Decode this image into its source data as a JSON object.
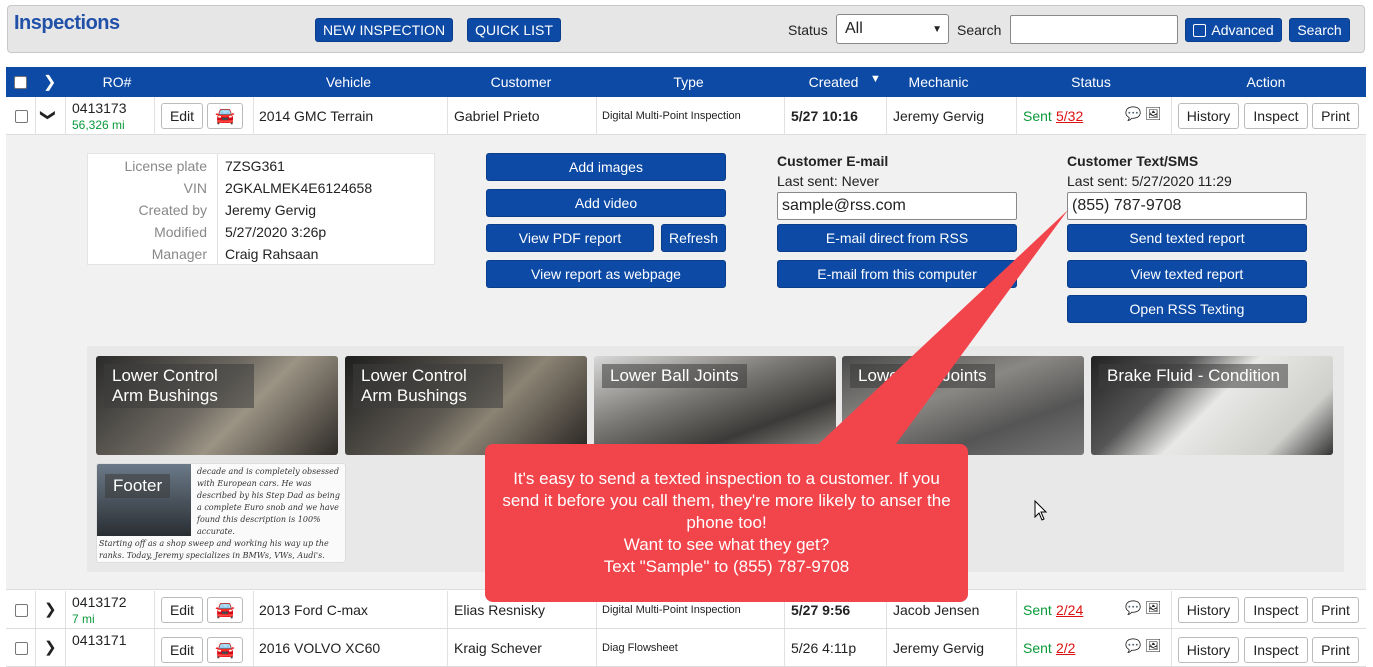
{
  "header": {
    "title": "Inspections",
    "new_inspection": "NEW INSPECTION",
    "quick_list": "QUICK LIST",
    "status_label": "Status",
    "status_value": "All",
    "search_label": "Search",
    "search_value": "",
    "advanced_label": "Advanced",
    "search_button": "Search"
  },
  "table": {
    "columns": [
      "RO#",
      "Vehicle",
      "Customer",
      "Type",
      "Created",
      "Mechanic",
      "Status",
      "Action"
    ]
  },
  "rows": [
    {
      "ro": "0413173",
      "miles": "56,326 mi",
      "vehicle": "2014 GMC Terrain",
      "customer": "Gabriel Prieto",
      "type": "Digital Multi-Point Inspection",
      "created": "5/27 10:16",
      "mechanic": "Jeremy Gervig",
      "status": "Sent",
      "status_count": "5/32"
    },
    {
      "ro": "0413172",
      "miles": "7 mi",
      "vehicle": "2013 Ford C-max",
      "customer": "Elias Resnisky",
      "type": "Digital Multi-Point Inspection",
      "created": "5/27 9:56",
      "mechanic": "Jacob Jensen",
      "status": "Sent",
      "status_count": "2/24"
    },
    {
      "ro": "0413171",
      "miles": "",
      "vehicle": "2016 VOLVO XC60",
      "customer": "Kraig Schever",
      "type": "Diag Flowsheet",
      "created": "5/26 4:11p",
      "mechanic": "Jeremy Gervig",
      "status": "Sent",
      "status_count": "2/2"
    }
  ],
  "row_actions": {
    "edit": "Edit",
    "history": "History",
    "inspect": "Inspect",
    "print": "Print"
  },
  "detail": {
    "info": [
      {
        "label": "License plate",
        "value": "7ZSG361"
      },
      {
        "label": "VIN",
        "value": "2GKALMEK4E6124658"
      },
      {
        "label": "Created by",
        "value": "Jeremy Gervig"
      },
      {
        "label": "Modified",
        "value": "5/27/2020 3:26p"
      },
      {
        "label": "Manager",
        "value": "Craig Rahsaan"
      }
    ],
    "buttons": {
      "add_images": "Add images",
      "add_video": "Add video",
      "view_pdf": "View PDF report",
      "refresh": "Refresh",
      "view_webpage": "View report as webpage"
    },
    "email": {
      "heading": "Customer E-mail",
      "last_sent": "Last sent: Never",
      "value": "sample@rss.com",
      "direct": "E-mail direct from RSS",
      "from_computer": "E-mail from this computer"
    },
    "sms": {
      "heading": "Customer Text/SMS",
      "last_sent": "Last sent: 5/27/2020 11:29",
      "value": "(855) 787-9708",
      "send": "Send texted report",
      "view": "View texted report",
      "open": "Open RSS Texting"
    },
    "gallery": [
      {
        "label": "Lower Control Arm Bushings"
      },
      {
        "label": "Lower Control Arm Bushings"
      },
      {
        "label": "Lower Ball Joints"
      },
      {
        "label": "Lower Ball Joints"
      },
      {
        "label": "Brake Fluid - Condition"
      },
      {
        "label": "Footer"
      }
    ],
    "footer_text": "decade and is completely obsessed with European cars. He was described by his Step Dad as being a complete Euro snob and we have found this description is 100% accurate.",
    "footer_text2": "Starting off as a shop sweep and working his way up the ranks. Today, Jeremy specializes in BMWs, VWs, Audi's."
  },
  "callout": {
    "line1": "It's easy to send a texted inspection to a customer. If you send it before you call them, they're more likely to anser the phone too!",
    "line2": "Want to see what they get?",
    "line3": "Text \"Sample\" to (855) 787-9708"
  },
  "colors": {
    "primary": "#0c4aa6",
    "callout": "#f2444b",
    "sent": "#0a9a3a"
  }
}
